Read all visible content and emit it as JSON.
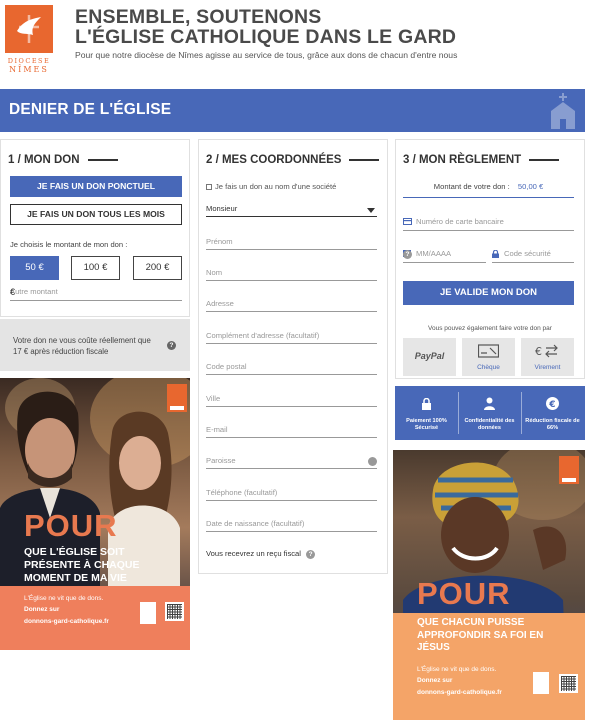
{
  "header": {
    "logo_line1": "DIOCESE",
    "logo_line2": "NÎMES",
    "title_line1": "ENSEMBLE, SOUTENONS",
    "title_line2": "L'ÉGLISE CATHOLIQUE DANS LE GARD",
    "subtitle": "Pour que notre diocèse de Nîmes agisse au service de tous, grâce aux dons de chacun d'entre nous"
  },
  "banner": {
    "title": "DENIER DE L'ÉGLISE"
  },
  "step1": {
    "title": "1 / MON DON",
    "btn_once": "JE FAIS UN DON PONCTUEL",
    "btn_monthly": "JE FAIS UN DON TOUS LES MOIS",
    "choose_label": "Je choisis le montant de mon don :",
    "amounts": [
      "50 €",
      "100 €",
      "200 €"
    ],
    "selected_amount": "50 €",
    "other_placeholder": "Autre montant",
    "currency": "€",
    "cost_text": "Votre don ne vous coûte réellement que 17 € après réduction fiscale"
  },
  "step2": {
    "title": "2 / MES COORDONNÉES",
    "company_checkbox": "Je fais un don au nom d'une société",
    "civility": "Monsieur",
    "fields": [
      "Prénom",
      "Nom",
      "Adresse",
      "Complément d'adresse (facultatif)",
      "Code postal",
      "Ville",
      "E-mail",
      "Paroisse",
      "Téléphone (facultatif)",
      "Date de naissance (facultatif)"
    ],
    "receipt": "Vous recevrez un reçu fiscal"
  },
  "step3": {
    "title": "3 / MON RÈGLEMENT",
    "amount_label": "Montant de votre don :",
    "amount_value": "50,00 €",
    "card_placeholder": "Numéro de carte bancaire",
    "expiry_placeholder": "MM/AAAA",
    "cvv_placeholder": "Code sécurité",
    "submit": "JE VALIDE MON DON",
    "alt_text": "Vous pouvez également faire votre don par",
    "pay_options": [
      "PayPal",
      "Chèque",
      "Virement"
    ]
  },
  "trust": {
    "items": [
      "Paiement 100% Sécurisé",
      "Confidentialité des données",
      "Réduction fiscale de 66%"
    ]
  },
  "poster1": {
    "pour": "POUR",
    "text": "QUE L'ÉGLISE SOIT PRÉSENTE À CHAQUE MOMENT DE MA VIE",
    "cta1": "L'Église ne vit que de dons.",
    "cta2": "Donnez sur",
    "cta3": "donnons-gard-catholique.fr"
  },
  "poster2": {
    "pour": "POUR",
    "text": "QUE CHACUN PUISSE APPROFONDIR SA FOI EN JÉSUS",
    "cta1": "L'Église ne vit que de dons.",
    "cta2": "Donnez sur",
    "cta3": "donnons-gard-catholique.fr"
  },
  "colors": {
    "accent": "#4868b8",
    "orange": "#e8672f",
    "grey_box": "#e4e4e4"
  }
}
